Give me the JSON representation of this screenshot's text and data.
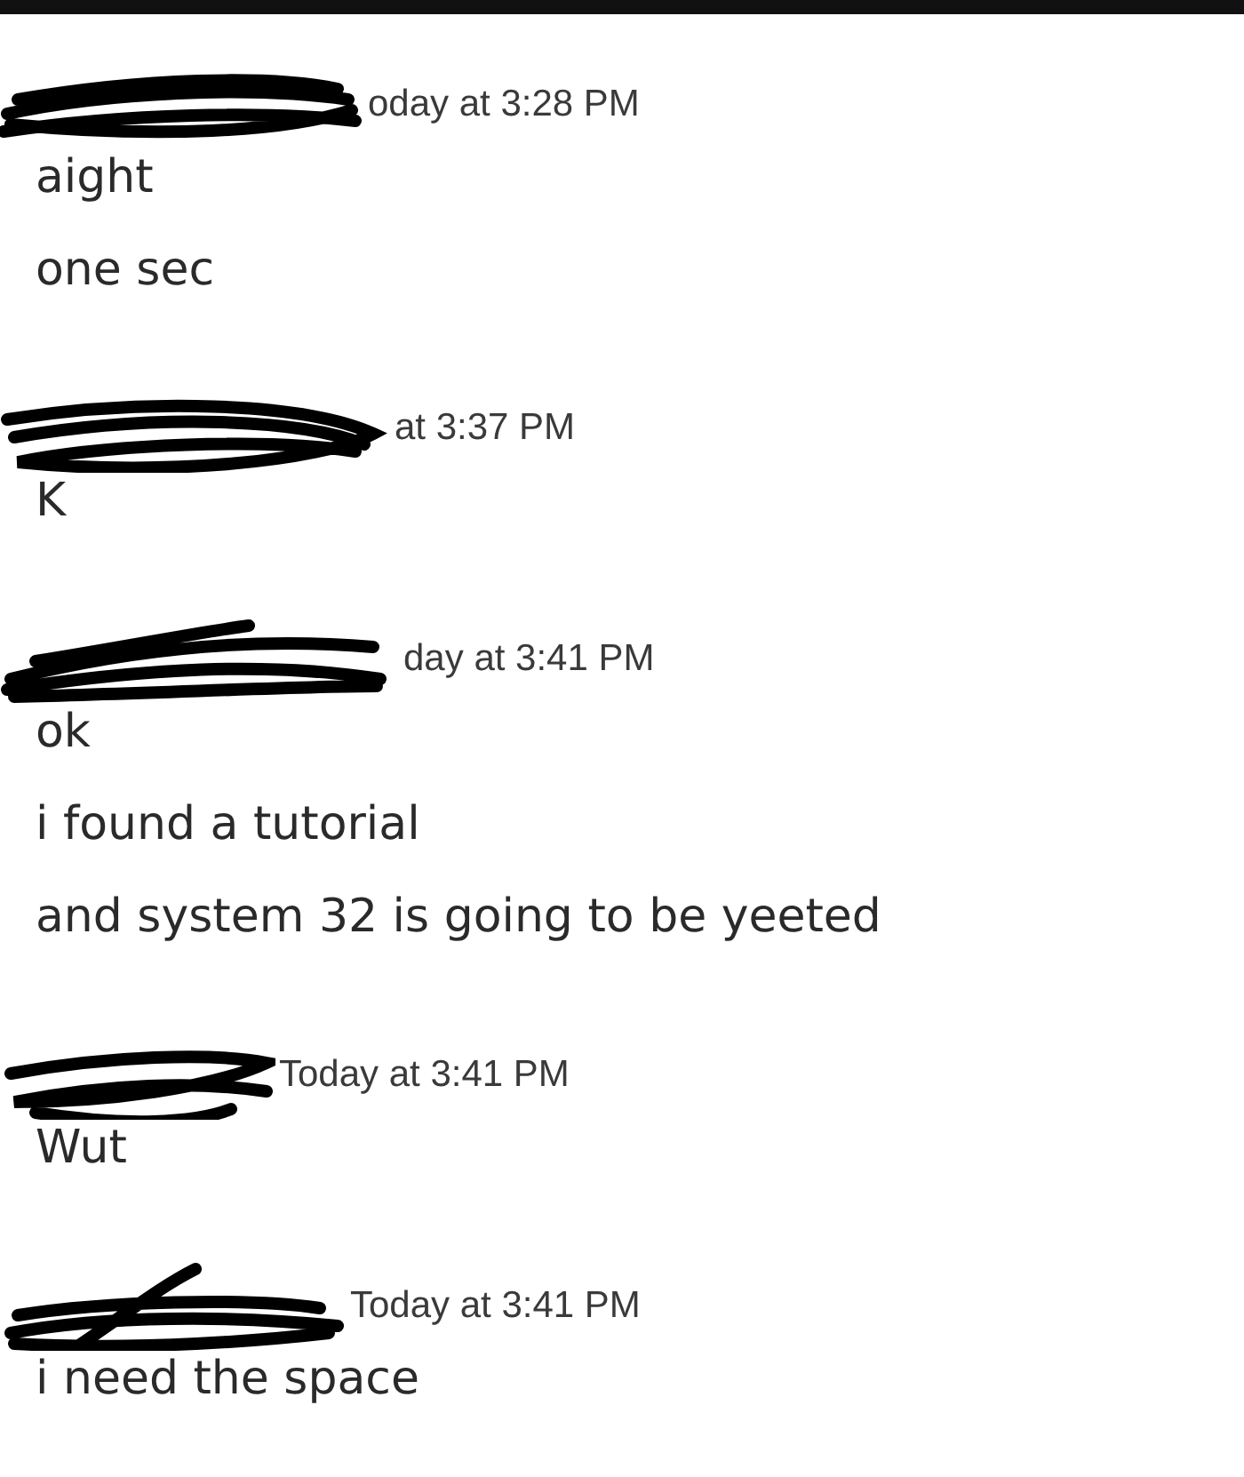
{
  "groups": [
    {
      "timestamp": "oday at 3:28 PM",
      "messages": [
        "aight",
        "one sec"
      ]
    },
    {
      "timestamp": "at 3:37 PM",
      "messages": [
        "K"
      ]
    },
    {
      "timestamp": "day at 3:41 PM",
      "messages": [
        "ok",
        "i found a tutorial",
        "and system 32 is going to be yeeted"
      ]
    },
    {
      "timestamp": "Today at 3:41 PM",
      "messages": [
        "Wut"
      ]
    },
    {
      "timestamp": "Today at 3:41 PM",
      "messages": [
        "i need the space"
      ]
    }
  ]
}
